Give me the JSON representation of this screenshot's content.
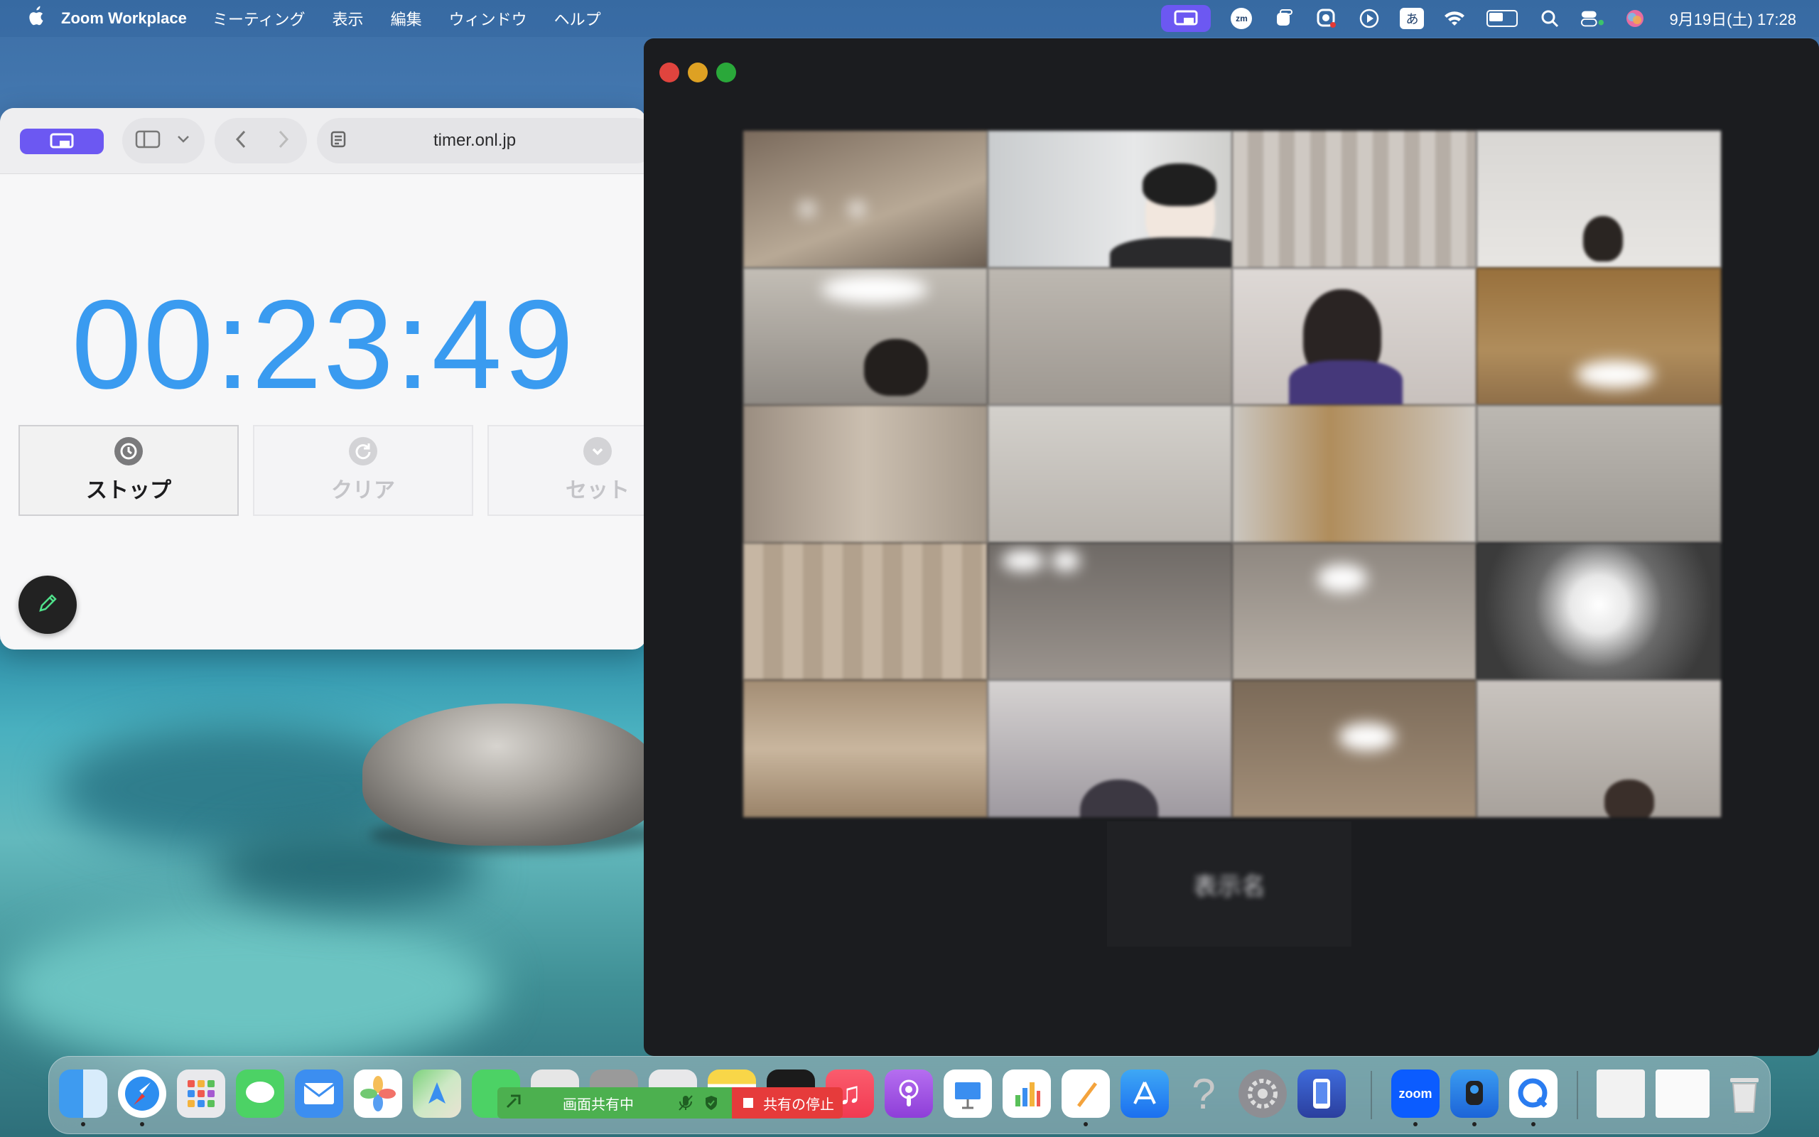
{
  "menubar": {
    "app_name": "Zoom Workplace",
    "menus": [
      "ミーティング",
      "表示",
      "編集",
      "ウィンドウ",
      "ヘルプ"
    ],
    "input_method": "あ",
    "zoom_badge": "zm",
    "clock": "9月19日(土) 17:28",
    "battery_level": 0.6
  },
  "browser": {
    "url": "timer.onl.jp",
    "timer": "00:23:49",
    "buttons": [
      {
        "label": "ストップ",
        "icon": "clock-icon",
        "state": "active"
      },
      {
        "label": "クリア",
        "icon": "reset-icon",
        "state": "disabled"
      },
      {
        "label": "セット",
        "icon": "check-icon",
        "state": "disabled"
      }
    ]
  },
  "zoom": {
    "participant_count_visible": 20,
    "name_tile_label": "表示名"
  },
  "share_bar": {
    "status": "画面共有中",
    "stop_label": "共有の停止"
  },
  "dock": {
    "zoom_label": "zoom",
    "apps": [
      "finder-icon",
      "safari-icon",
      "launchpad-icon",
      "messages-icon",
      "mail-icon",
      "photos-icon",
      "maps-icon",
      "facetime-icon",
      "calculator-icon",
      "settings-icon",
      "contacts-icon",
      "notes-icon",
      "tv-icon",
      "music-icon",
      "podcasts-icon",
      "keynote-icon",
      "numbers-icon",
      "pages-icon",
      "app-store-icon",
      "help-icon",
      "system-settings-icon",
      "iphone-mirroring-icon",
      "zoom-icon",
      "webcam-icon",
      "quicktime-icon",
      "document-icon",
      "document-icon",
      "trash-icon"
    ]
  },
  "colors": {
    "accent_blue": "#3a9bf0",
    "share_purple": "#6c58f2",
    "share_green": "#4cb04f",
    "stop_red": "#e63b3b"
  }
}
